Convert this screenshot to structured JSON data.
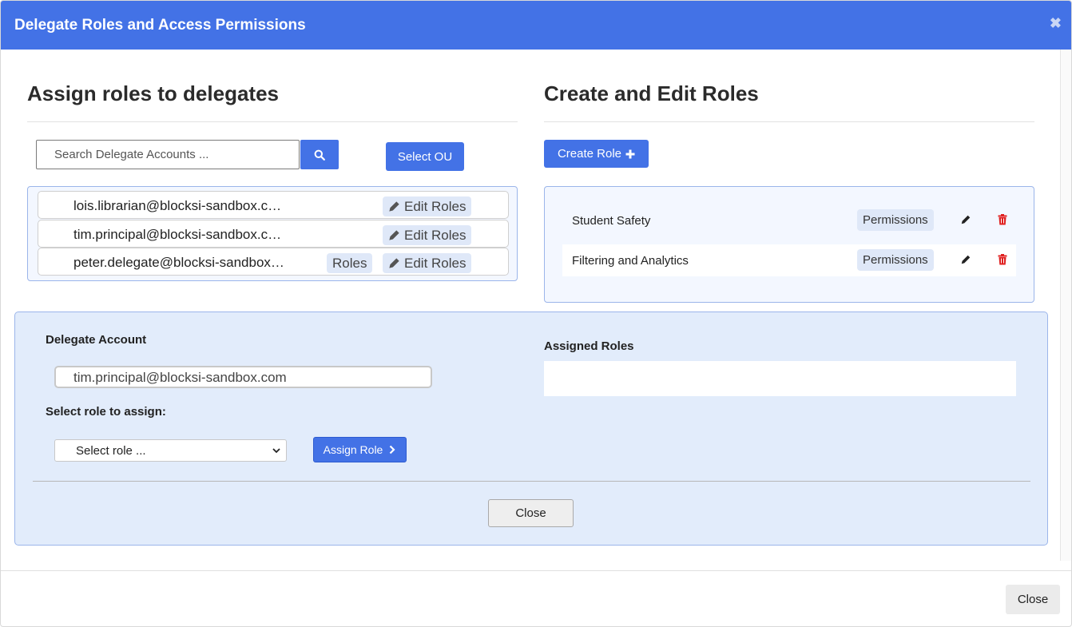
{
  "modal": {
    "title": "Delegate Roles and Access Permissions",
    "close_glyph": "✖"
  },
  "left": {
    "title": "Assign roles to delegates",
    "search_placeholder": "Search Delegate Accounts ...",
    "select_ou_label": "Select OU",
    "delegates": [
      {
        "email": "lois.librarian@blocksi-sandbox.c…",
        "edit_label": "Edit Roles",
        "roles_label": ""
      },
      {
        "email": "tim.principal@blocksi-sandbox.c…",
        "edit_label": "Edit Roles",
        "roles_label": ""
      },
      {
        "email": "peter.delegate@blocksi-sandbox…",
        "edit_label": "Edit Roles",
        "roles_label": "Roles"
      }
    ]
  },
  "right": {
    "title": "Create and Edit Roles",
    "create_role_label": "Create Role",
    "roles": [
      {
        "name": "Student Safety",
        "permissions_label": "Permissions"
      },
      {
        "name": "Filtering and Analytics",
        "permissions_label": "Permissions"
      }
    ]
  },
  "assign": {
    "delegate_account_label": "Delegate Account",
    "delegate_account_value": "tim.principal@blocksi-sandbox.com",
    "select_role_label": "Select role to assign:",
    "select_role_value": "Select role ...",
    "assign_role_label": "Assign Role",
    "assigned_roles_label": "Assigned Roles",
    "close_label": "Close"
  },
  "footer": {
    "close_label": "Close"
  },
  "colors": {
    "primary": "#4372e6",
    "danger": "#e02020",
    "panel_bg": "#e2ecfb"
  }
}
